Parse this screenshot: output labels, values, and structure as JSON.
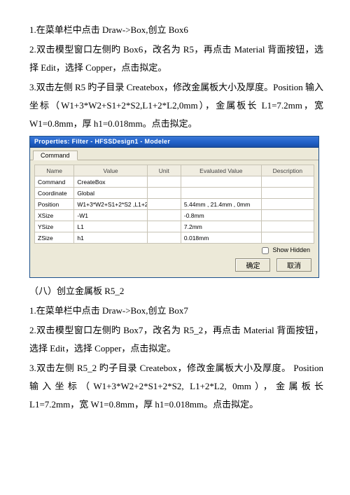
{
  "para1": "1.在菜单栏中点击 Draw->Box,创立 Box6",
  "para2": "2.双击模型窗口左侧旳 Box6，改名为 R5，再点击 Material 背面按钮，选择 Edit，选择 Copper，点击拟定。",
  "para3": "3.双击左侧 R5 旳子目录 Createbox，修改金属板大小及厚度。Position 输入坐标（W1+3*W2+S1+2*S2,L1+2*L2,0mm），金属板长 L1=7.2mm，宽 W1=0.8mm，厚 h1=0.018mm。点击拟定。",
  "dialog": {
    "title": "Properties: Filter - HFSSDesign1 - Modeler",
    "tab": "Command",
    "headers": {
      "name": "Name",
      "value": "Value",
      "unit": "Unit",
      "eval": "Evaluated Value",
      "desc": "Description"
    },
    "rows": [
      {
        "name": "Command",
        "value": "CreateBox",
        "unit": "",
        "eval": ""
      },
      {
        "name": "Coordinate",
        "value": "Global",
        "unit": "",
        "eval": ""
      },
      {
        "name": "Position",
        "value": "W1+3*W2+S1+2*S2 ,L1+2",
        "unit": "",
        "eval": "5.44mm , 21.4mm , 0mm"
      },
      {
        "name": "XSize",
        "value": "-W1",
        "unit": "",
        "eval": "-0.8mm"
      },
      {
        "name": "YSize",
        "value": "L1",
        "unit": "",
        "eval": "7.2mm"
      },
      {
        "name": "ZSize",
        "value": "h1",
        "unit": "",
        "eval": "0.018mm"
      }
    ],
    "show_hidden": "Show Hidden",
    "ok": "确定",
    "cancel": "取消"
  },
  "heading8": "（八）创立金属板 R5_2",
  "para4": "1.在菜单栏中点击 Draw->Box,创立 Box7",
  "para5": "2.双击模型窗口左侧旳 Box7，改名为 R5_2，再点击 Material 背面按钮，选择 Edit，选择 Copper，点击拟定。",
  "para6": "3.双击左侧 R5_2 旳子目录 Createbox，修改金属板大小及厚度。 Position 输入坐标（W1+3*W2+2*S1+2*S2, L1+2*L2, 0mm），金属板长 L1=7.2mm，宽 W1=0.8mm，厚 h1=0.018mm。点击拟定。"
}
